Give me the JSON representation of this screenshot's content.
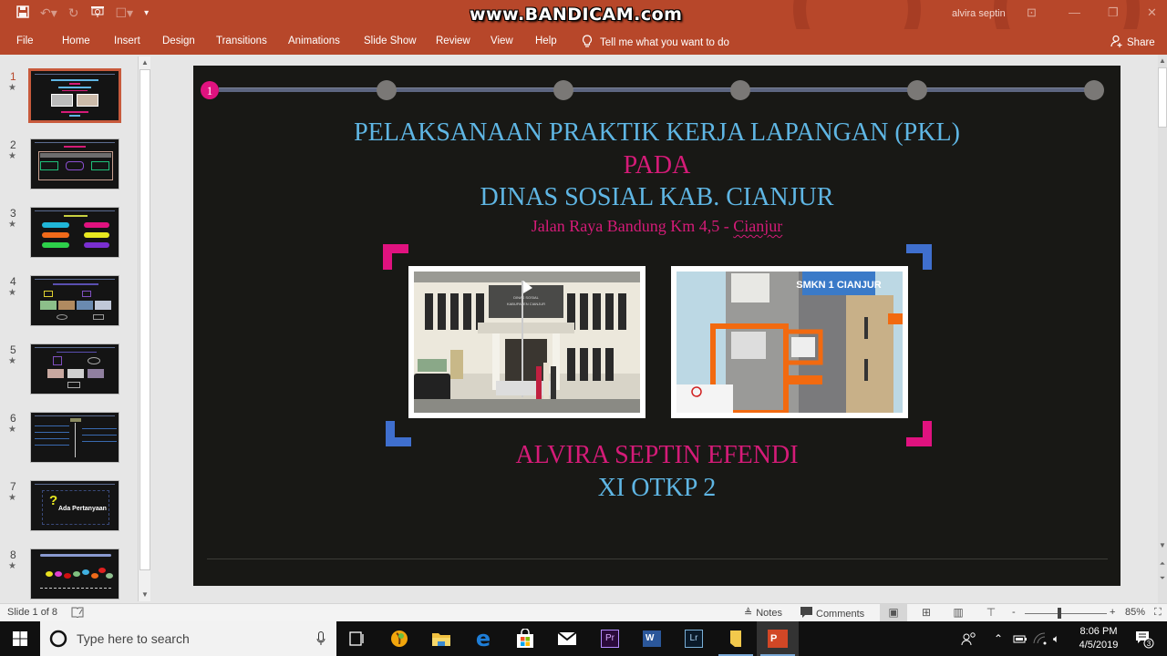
{
  "app": {
    "watermark": "www.BANDICAM.com",
    "user_name": "alvira septin",
    "window_controls": {
      "ribbon_display": "⊡",
      "minimize": "—",
      "restore": "❐",
      "close": "✕"
    }
  },
  "quick_access": {
    "save": "save-icon",
    "undo": "undo-icon",
    "redo": "redo-icon",
    "present": "present-from-start-icon",
    "shape": "shape-icon",
    "customize": "customize-qat-icon"
  },
  "ribbon_tabs": [
    {
      "label": "File"
    },
    {
      "label": "Home"
    },
    {
      "label": "Insert"
    },
    {
      "label": "Design"
    },
    {
      "label": "Transitions"
    },
    {
      "label": "Animations"
    },
    {
      "label": "Slide Show"
    },
    {
      "label": "Review"
    },
    {
      "label": "View"
    },
    {
      "label": "Help"
    }
  ],
  "tell_me": {
    "placeholder": "Tell me what you want to do",
    "icon": "lightbulb-icon"
  },
  "share": {
    "label": "Share",
    "icon": "person-add-icon"
  },
  "thumbnails": [
    {
      "number": "1",
      "active": true
    },
    {
      "number": "2",
      "active": false
    },
    {
      "number": "3",
      "active": false
    },
    {
      "number": "4",
      "active": false
    },
    {
      "number": "5",
      "active": false
    },
    {
      "number": "6",
      "active": false
    },
    {
      "number": "7",
      "active": false,
      "caption": "Ada Pertanyaan"
    },
    {
      "number": "8",
      "active": false
    }
  ],
  "slide": {
    "progress": {
      "current": "1",
      "total_steps": 6
    },
    "title_line1": "PELAKSANAAN PRAKTIK KERJA LAPANGAN (PKL)",
    "title_line2": "PADA",
    "title_line3": "DINAS SOSIAL KAB. CIANJUR",
    "address_main": "Jalan Raya Bandung Km 4,5 - ",
    "address_city": "Cianjur",
    "photo_left": {
      "alt": "Dinas Sosial Kabupaten Cianjur building",
      "sign": "DINAS SOSIAL KABUPATEN CIANJUR"
    },
    "photo_right": {
      "alt": "SMKN 1 Cianjur building",
      "sign": "SMKN 1 CIANJUR"
    },
    "author": "ALVIRA SEPTIN EFENDI",
    "class_name": "XI OTKP 2",
    "colors": {
      "blue": "#5fb6e4",
      "pink": "#d51b78",
      "accent_pink": "#e0127f",
      "accent_blue": "#3f6fce"
    }
  },
  "statusbar": {
    "slide_indicator": "Slide 1 of 8",
    "notes_label": "Notes",
    "comments_label": "Comments",
    "zoom_minus": "-",
    "zoom_plus": "+",
    "zoom_level": "85%",
    "zoom_percent": 85
  },
  "taskbar": {
    "search_placeholder": "Type here to search",
    "apps": [
      {
        "name": "task-view"
      },
      {
        "name": "fl-studio"
      },
      {
        "name": "file-explorer"
      },
      {
        "name": "edge"
      },
      {
        "name": "store"
      },
      {
        "name": "mail"
      },
      {
        "name": "premiere-pro",
        "label": "Pr"
      },
      {
        "name": "word",
        "label": "W"
      },
      {
        "name": "lightroom",
        "label": "Lr"
      },
      {
        "name": "folder"
      },
      {
        "name": "powerpoint",
        "label": "P"
      }
    ],
    "time": "8:06 PM",
    "date": "4/5/2019",
    "notification_count": "3"
  }
}
